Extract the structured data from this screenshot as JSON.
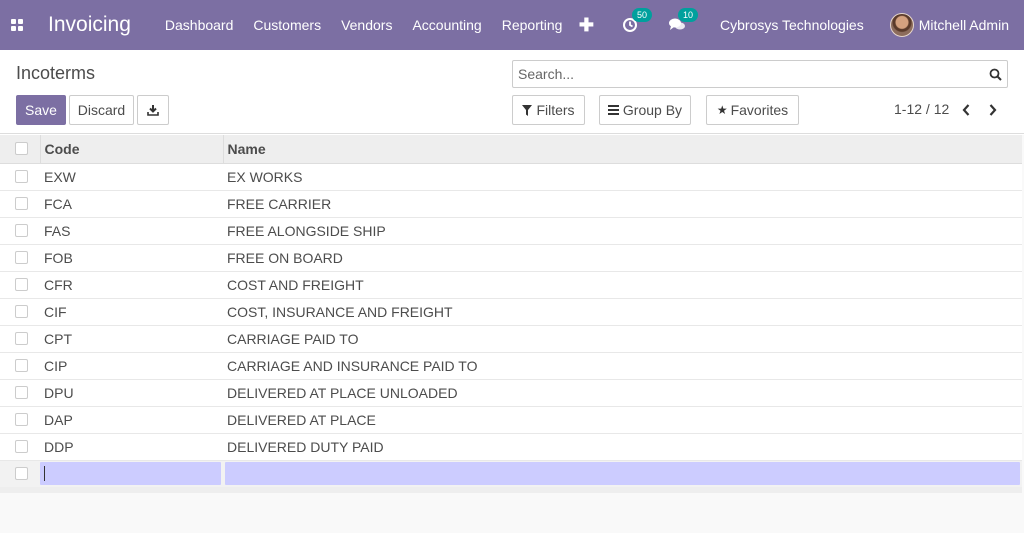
{
  "navbar": {
    "app_name": "Invoicing",
    "menu": [
      "Dashboard",
      "Customers",
      "Vendors",
      "Accounting",
      "Reporting"
    ],
    "activity_count": "50",
    "message_count": "10",
    "company": "Cybrosys Technologies",
    "user": "Mitchell Admin"
  },
  "control_panel": {
    "breadcrumb": "Incoterms",
    "search_placeholder": "Search...",
    "save_label": "Save",
    "discard_label": "Discard",
    "filters_label": "Filters",
    "group_by_label": "Group By",
    "favorites_label": "Favorites",
    "pager": "1-12 / 12"
  },
  "table": {
    "columns": [
      "Code",
      "Name"
    ],
    "rows": [
      {
        "code": "EXW",
        "name": "EX WORKS"
      },
      {
        "code": "FCA",
        "name": "FREE CARRIER"
      },
      {
        "code": "FAS",
        "name": "FREE ALONGSIDE SHIP"
      },
      {
        "code": "FOB",
        "name": "FREE ON BOARD"
      },
      {
        "code": "CFR",
        "name": "COST AND FREIGHT"
      },
      {
        "code": "CIF",
        "name": "COST, INSURANCE AND FREIGHT"
      },
      {
        "code": "CPT",
        "name": "CARRIAGE PAID TO"
      },
      {
        "code": "CIP",
        "name": "CARRIAGE AND INSURANCE PAID TO"
      },
      {
        "code": "DPU",
        "name": "DELIVERED AT PLACE UNLOADED"
      },
      {
        "code": "DAP",
        "name": "DELIVERED AT PLACE"
      },
      {
        "code": "DDP",
        "name": "DELIVERED DUTY PAID"
      }
    ]
  },
  "colors": {
    "brand": "#7c6fa3",
    "badge": "#00a09d",
    "edit_highlight": "#ccccff"
  }
}
